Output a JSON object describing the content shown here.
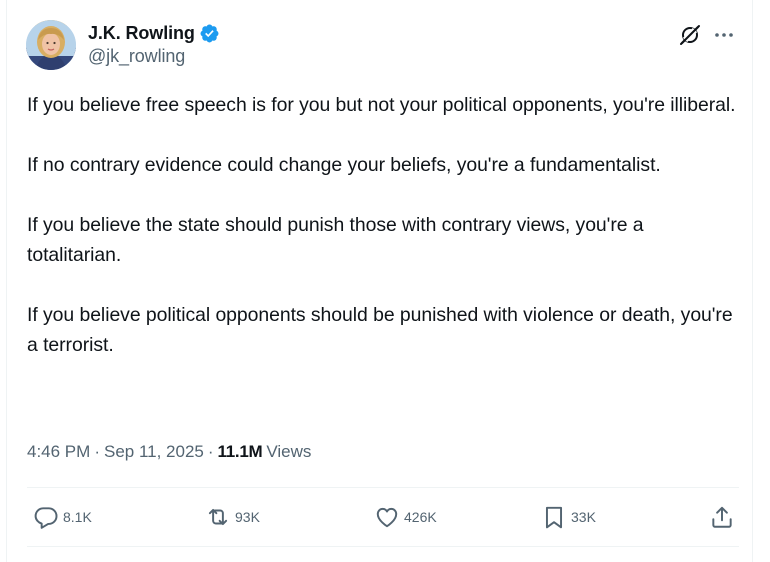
{
  "author": {
    "display_name": "J.K. Rowling",
    "handle": "@jk_rowling",
    "verified": true
  },
  "header_icons": {
    "grok": "grok-icon",
    "more": "more-icon"
  },
  "post": {
    "paragraphs": [
      "If you believe free speech is for you but not your political opponents, you're illiberal.",
      "If no contrary evidence could change your beliefs, you're a fundamentalist.",
      "If you believe the state should punish those with contrary views, you're a totalitarian.",
      "If you believe political opponents should be punished with violence or death, you're a terrorist."
    ]
  },
  "meta": {
    "time": "4:46 PM",
    "separator": "·",
    "date": "Sep 11, 2025",
    "views_count": "11.1M",
    "views_label": "Views"
  },
  "actions": {
    "replies": "8.1K",
    "reposts": "93K",
    "likes": "426K",
    "bookmarks": "33K"
  },
  "colors": {
    "text_primary": "#0f1419",
    "text_secondary": "#536471",
    "verified_blue": "#1d9bf0",
    "divider": "#eff3f4"
  }
}
